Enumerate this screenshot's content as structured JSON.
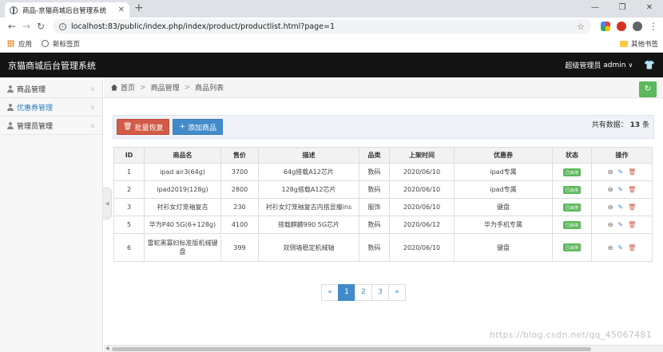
{
  "browser": {
    "tab_title": "商品-京猫商城后台管理系统",
    "tab_close": "✕",
    "new_tab": "+",
    "url": "localhost:83/public/index.php/index/product/productlist.html?page=1",
    "bookmarks": [
      {
        "label": "应用",
        "icon": "apps-icon"
      },
      {
        "label": "新标签页",
        "icon": "globe-icon"
      }
    ],
    "other_bookmarks": "其他书签",
    "window_controls": [
      "—",
      "❐",
      "✕"
    ]
  },
  "app": {
    "title": "京猫商城后台管理系统",
    "admin_label": "超级管理员",
    "admin_name": "admin"
  },
  "sidebar": {
    "items": [
      {
        "label": "商品管理",
        "active": false
      },
      {
        "label": "优惠券管理",
        "active": true
      },
      {
        "label": "管理员管理",
        "active": false
      }
    ]
  },
  "breadcrumb": [
    "首页",
    "商品管理",
    "商品列表"
  ],
  "toolbar": {
    "bulk_restore": "批量恢复",
    "add_product": "添加商品",
    "total_prefix": "共有数据：",
    "total_count": "13",
    "total_suffix": "条"
  },
  "table": {
    "headers": [
      "ID",
      "商品名",
      "售价",
      "描述",
      "品类",
      "上架时间",
      "优惠券",
      "状态",
      "操作"
    ],
    "rows": [
      {
        "id": "1",
        "name": "ipad air3(64g)",
        "price": "3700",
        "desc": "64g搭载A12芯片",
        "category": "数码",
        "date": "2020/06/10",
        "coupon": "ipad专属",
        "status": "已启用"
      },
      {
        "id": "2",
        "name": "ipad2019(128g)",
        "price": "2800",
        "desc": "128g搭载A12芯片",
        "category": "数码",
        "date": "2020/06/10",
        "coupon": "ipad专属",
        "status": "已启用"
      },
      {
        "id": "3",
        "name": "衬衫女灯笼袖复古",
        "price": "230",
        "desc": "衬衫女灯笼袖复古内搭显瘦ins",
        "category": "服饰",
        "date": "2020/06/10",
        "coupon": "键盘",
        "status": "已启用"
      },
      {
        "id": "5",
        "name": "华为P40 5G(6+128g)",
        "price": "4100",
        "desc": "搭载麒麟990 5G芯片",
        "category": "数码",
        "date": "2020/06/12",
        "coupon": "华为手机专属",
        "status": "已启用"
      },
      {
        "id": "6",
        "name": "雷蛇黑寡妇标准版机械键盘",
        "price": "399",
        "desc": "双侧墙稳定机械轴",
        "category": "数码",
        "date": "2020/06/10",
        "coupon": "键盘",
        "status": "已启用"
      }
    ]
  },
  "pagination": {
    "prev": "«",
    "pages": [
      "1",
      "2",
      "3"
    ],
    "current": "1",
    "next": "»"
  },
  "watermark": "https://blog.csdn.net/qq_45067481",
  "colors": {
    "header_bg": "#141414",
    "danger": "#d15b47",
    "primary": "#428bca",
    "success": "#5cb85c",
    "active_link": "#2b7dbc"
  }
}
